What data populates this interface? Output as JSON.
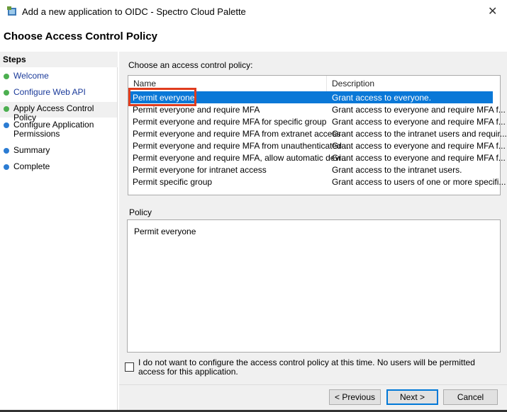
{
  "window": {
    "title": "Add a new application to OIDC - Spectro Cloud Palette",
    "close": "✕"
  },
  "page_title": "Choose Access Control Policy",
  "sidebar": {
    "header": "Steps",
    "items": [
      {
        "label": "Welcome",
        "status": "done"
      },
      {
        "label": "Configure Web API",
        "status": "done"
      },
      {
        "label": "Apply Access Control Policy",
        "status": "current"
      },
      {
        "label": "Configure Application Permissions",
        "status": "pending"
      },
      {
        "label": "Summary",
        "status": "pending"
      },
      {
        "label": "Complete",
        "status": "pending"
      }
    ]
  },
  "main": {
    "choose_label": "Choose an access control policy:",
    "columns": [
      "Name",
      "Description"
    ],
    "rows": [
      [
        "Permit everyone",
        "Grant access to everyone."
      ],
      [
        "Permit everyone and require MFA",
        "Grant access to everyone and require MFA f..."
      ],
      [
        "Permit everyone and require MFA for specific group",
        "Grant access to everyone and require MFA f..."
      ],
      [
        "Permit everyone and require MFA from extranet access",
        "Grant access to the intranet users and requir..."
      ],
      [
        "Permit everyone and require MFA from unauthenticated ...",
        "Grant access to everyone and require MFA f..."
      ],
      [
        "Permit everyone and require MFA, allow automatic devi...",
        "Grant access to everyone and require MFA f..."
      ],
      [
        "Permit everyone for intranet access",
        "Grant access to the intranet users."
      ],
      [
        "Permit specific group",
        "Grant access to users of one or more specifi..."
      ]
    ],
    "selected_index": 0,
    "policy_label": "Policy",
    "policy_text": "Permit everyone",
    "checkbox_label": "I do not want to configure the access control policy at this time.  No users will be permitted access for this application.",
    "checkbox_checked": false
  },
  "buttons": {
    "previous": "< Previous",
    "next": "Next >",
    "cancel": "Cancel"
  },
  "colors": {
    "selection": "#0a78d7",
    "highlight_box": "#e03c1e",
    "done": "#4caf50",
    "pending": "#2b7cd3"
  }
}
